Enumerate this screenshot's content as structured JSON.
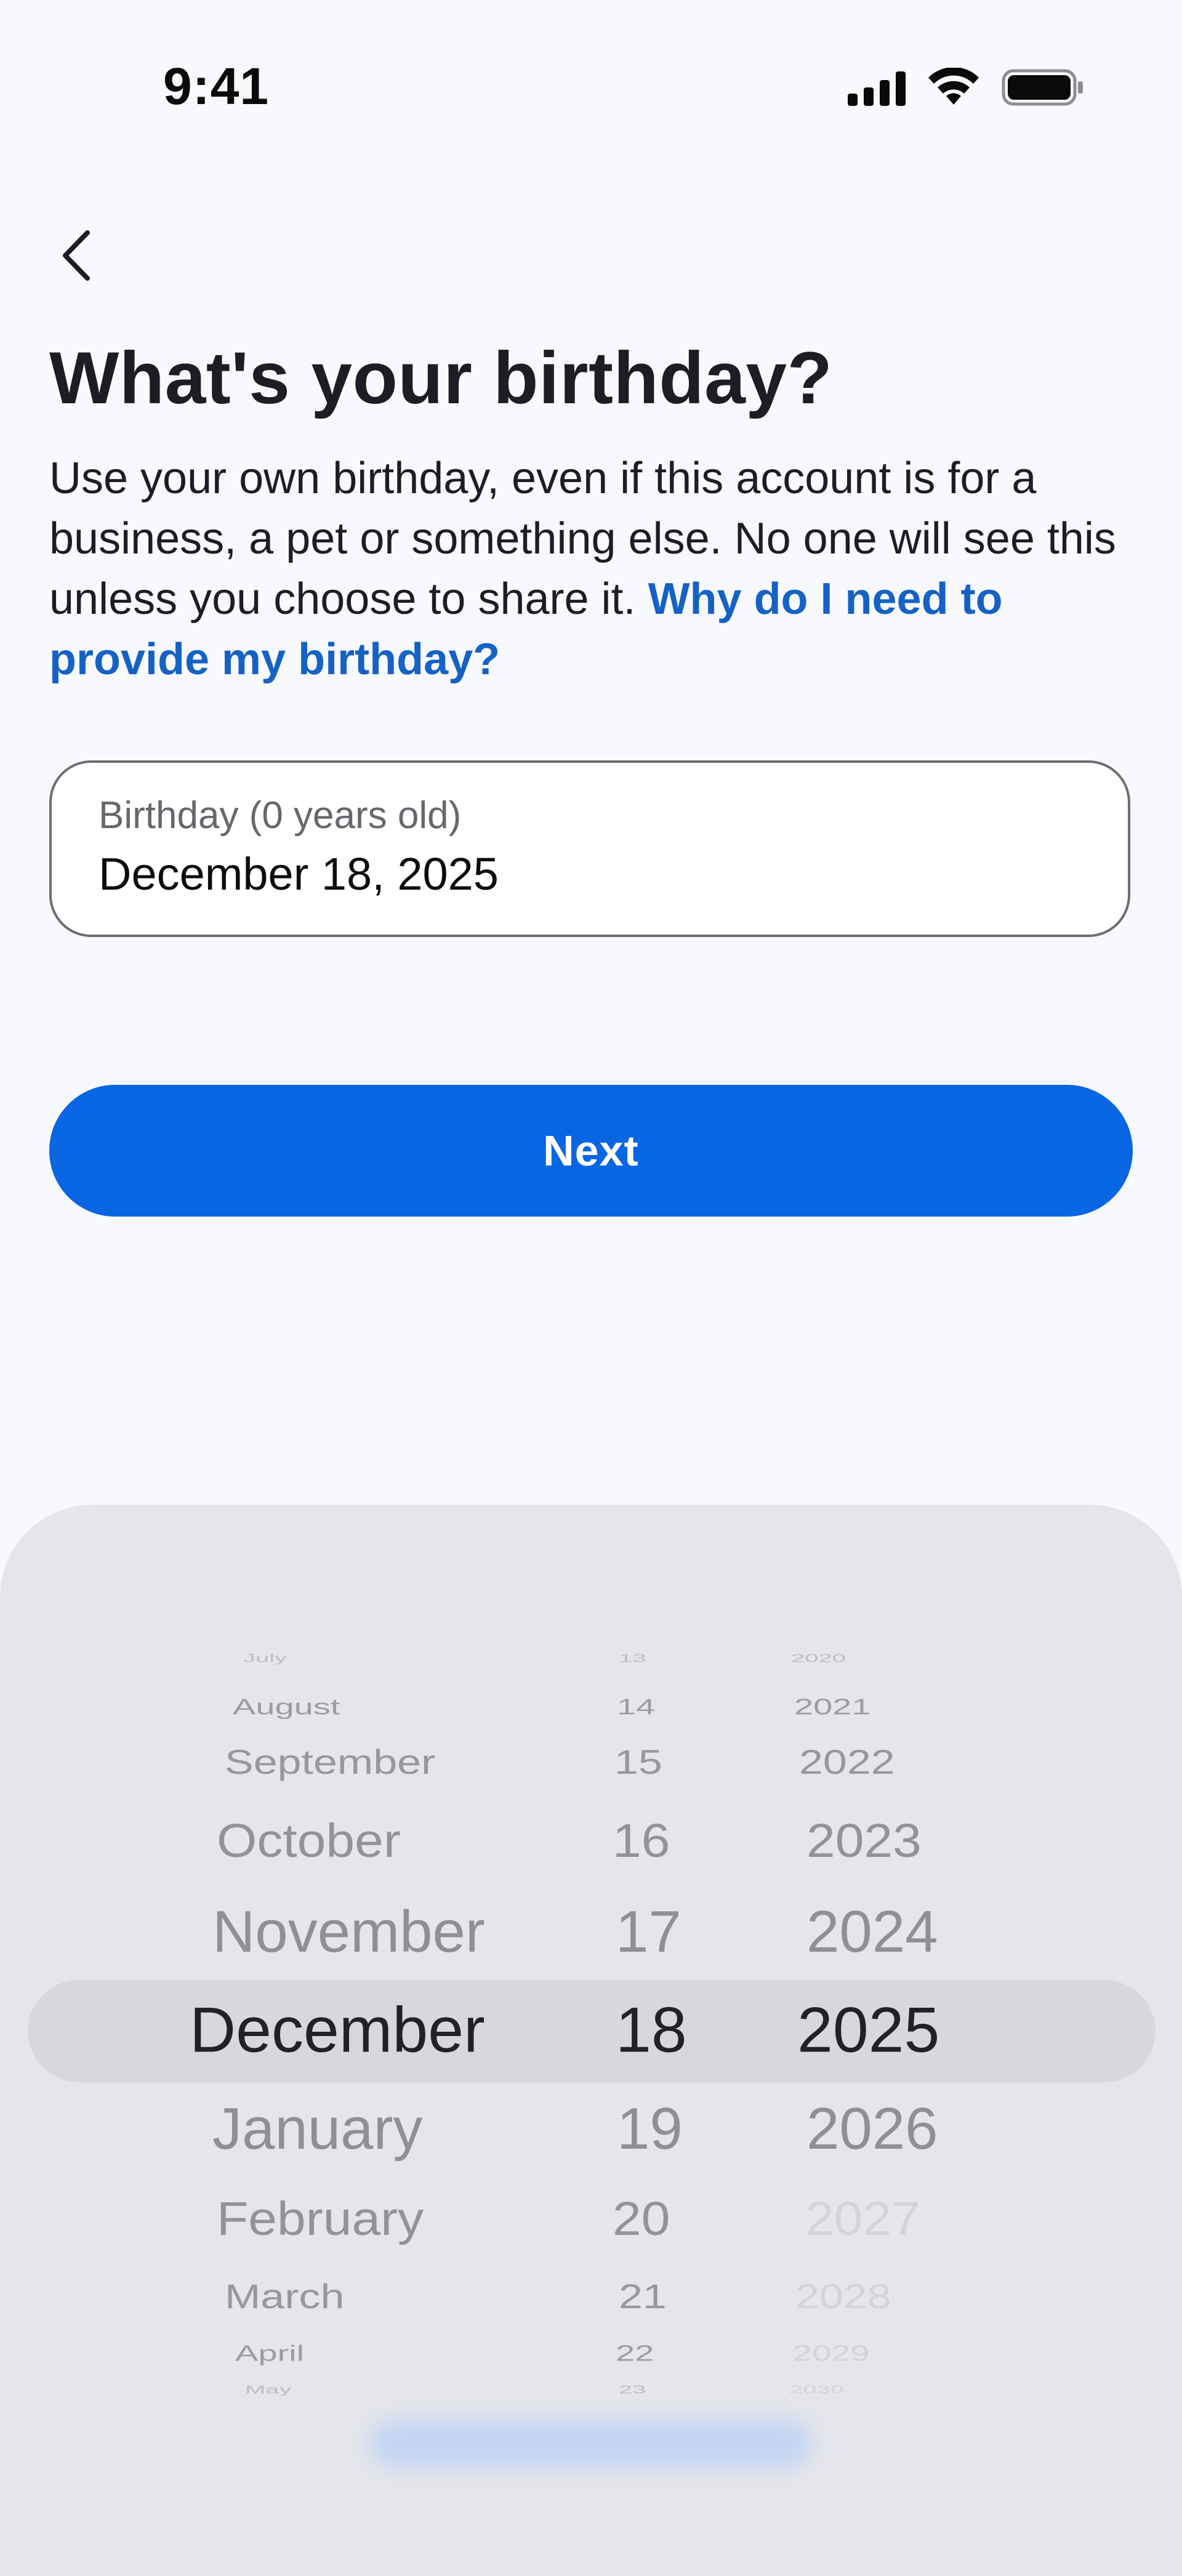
{
  "status_bar": {
    "time": "9:41"
  },
  "header": {
    "back_icon": "chevron-left-icon",
    "title": "What's your birthday?",
    "description": "Use your own birthday, even if this account is for a business, a pet or something else. No one will see this unless you choose to share it.",
    "help_link": "Why do I need to provide my birthday?"
  },
  "birthday_field": {
    "label": "Birthday (0 years old)",
    "value": "December 18, 2025"
  },
  "next_button": {
    "label": "Next",
    "color": "#0866e3"
  },
  "date_picker": {
    "months": [
      "July",
      "August",
      "September",
      "October",
      "November",
      "December",
      "January",
      "February",
      "March",
      "April",
      "May"
    ],
    "days": [
      "13",
      "14",
      "15",
      "16",
      "17",
      "18",
      "19",
      "20",
      "21",
      "22",
      "23"
    ],
    "years": [
      "2020",
      "2021",
      "2022",
      "2023",
      "2024",
      "2025",
      "2026",
      "2027",
      "2028",
      "2029",
      "2030"
    ],
    "selected_month": "December",
    "selected_day": "18",
    "selected_year": "2025",
    "disabled_years": [
      "2027",
      "2028",
      "2029",
      "2030"
    ]
  }
}
